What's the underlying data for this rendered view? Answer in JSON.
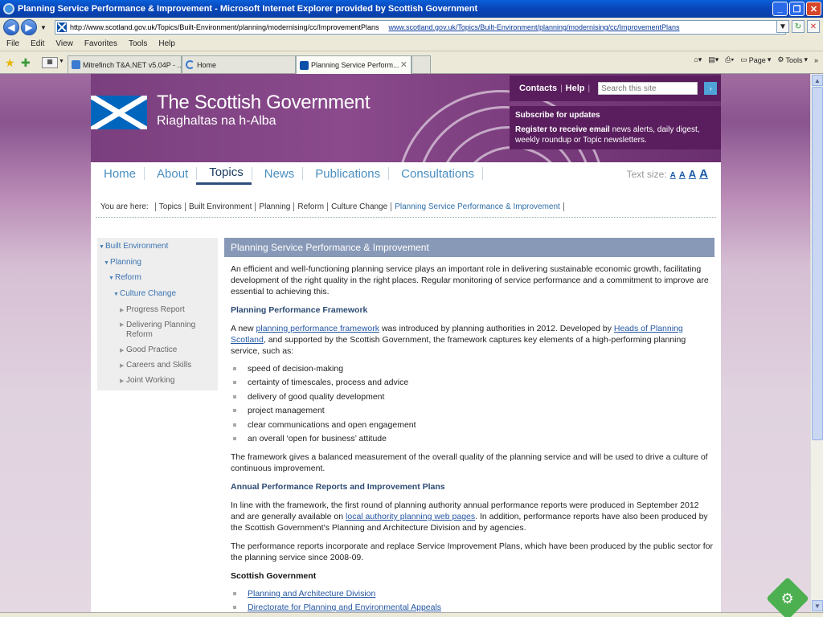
{
  "window": {
    "title": "Planning Service Performance & Improvement - Microsoft Internet Explorer provided by Scottish Government"
  },
  "browser": {
    "address_url": "http://www.scotland.gov.uk/Topics/Built-Environment/planning/modernising/cc/ImprovementPlans",
    "address_url_display": "www.scotland.gov.uk/Topics/Built-Environment/planning/modernising/cc/ImprovementPlans",
    "menu": [
      "File",
      "Edit",
      "View",
      "Favorites",
      "Tools",
      "Help"
    ],
    "tabs": [
      {
        "label": "Mitrefinch T&A.NET v5.04P - ..."
      },
      {
        "label": "Home"
      },
      {
        "label": "Planning Service Perform..."
      }
    ],
    "command_bar": {
      "page": "Page",
      "tools": "Tools"
    }
  },
  "header": {
    "logo_title": "The Scottish Government",
    "logo_subtitle": "Riaghaltas na h-Alba",
    "contacts": "Contacts",
    "help": "Help",
    "search_placeholder": "Search this site",
    "subscribe_heading": "Subscribe for updates",
    "subscribe_strong": "Register to receive email",
    "subscribe_text": " news alerts, daily digest, weekly roundup or Topic newsletters."
  },
  "nav": {
    "items": [
      "Home",
      "About",
      "Topics",
      "News",
      "Publications",
      "Consultations"
    ],
    "current": "Topics",
    "text_size_label": "Text size:",
    "text_size_options": [
      "A",
      "A",
      "A",
      "A"
    ]
  },
  "breadcrumb": {
    "label": "You are here:",
    "items": [
      "Topics",
      "Built Environment",
      "Planning",
      "Reform",
      "Culture Change",
      "Planning Service Performance & Improvement"
    ]
  },
  "sidebar": {
    "items": [
      {
        "label": "Built Environment"
      },
      {
        "label": "Planning"
      },
      {
        "label": "Reform"
      },
      {
        "label": "Culture Change"
      },
      {
        "label": "Progress Report"
      },
      {
        "label": "Delivering Planning Reform"
      },
      {
        "label": "Good Practice"
      },
      {
        "label": "Careers and Skills"
      },
      {
        "label": "Joint Working"
      }
    ]
  },
  "main": {
    "title": "Planning Service Performance & Improvement",
    "intro": "An efficient and well-functioning planning service plays an important role in delivering sustainable economic growth, facilitating development of the right quality in the right places.  Regular monitoring of service performance and a commitment to improve are essential to achieving this.",
    "h_framework": "Planning Performance Framework",
    "fw_a": "A new ",
    "fw_link1": "planning performance framework",
    "fw_b": " was introduced by planning authorities in 2012.  Developed by ",
    "fw_link2": "Heads of Planning Scotland",
    "fw_c": ", and supported by the Scottish Government, the framework captures key elements of a high-performing planning service, such as:",
    "bullets": [
      "speed of decision-making",
      "certainty of timescales, process and advice",
      "delivery of good quality development",
      "project management",
      "clear communications and open engagement",
      "an overall ‘open for business’ attitude"
    ],
    "fw_summary": "The framework gives a balanced measurement of the overall quality of the planning service and will be used to drive a culture of continuous improvement.",
    "h_reports": "Annual Performance Reports and Improvement Plans",
    "rep_a": "In line with the framework, the first round of planning authority annual performance reports were produced in September 2012 and are generally available on ",
    "rep_link": "local authority planning web pages",
    "rep_b": ". In addition, performance reports have also been produced by the Scottish Government’s Planning and Architecture Division and by agencies.",
    "rep_2": "The performance reports incorporate and replace Service Improvement Plans, which have been produced by the public sector for the planning service since 2008-09.",
    "h_sg": "Scottish Government",
    "sg_links": [
      "Planning and Architecture Division",
      "Directorate for Planning and Environmental Appeals"
    ]
  }
}
